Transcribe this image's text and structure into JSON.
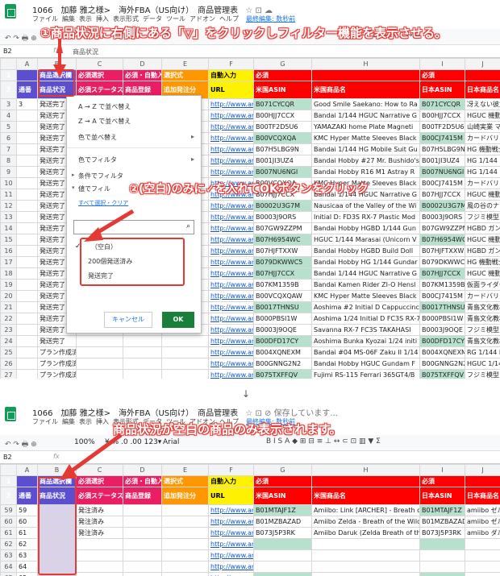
{
  "doc": {
    "title": "1066　加藤 雅之様>　海外FBA（US向け）　商品管理表",
    "title_icons": "☆ ⊡ ☁",
    "bot_title_icons": "☆ ⊡ ⊘ 保存しています..."
  },
  "menu": {
    "items": [
      "ファイル",
      "編集",
      "表示",
      "挿入",
      "表示形式",
      "データ",
      "ツール",
      "アドオン",
      "ヘルプ"
    ],
    "last_edit": "最終編集: 数秒前"
  },
  "formula_bar": {
    "cell_ref": "B2",
    "value": "商品状況"
  },
  "columns": [
    "",
    "A",
    "B",
    "C",
    "D",
    "E",
    "F",
    "G",
    "H",
    "I",
    "J"
  ],
  "header_row1": {
    "b": "商品選択欄",
    "c": "必須選択",
    "d": "必須・自動入",
    "e": "選択式",
    "f": "自動入力",
    "g": "必須",
    "i": "必須"
  },
  "header_row2": {
    "a": "通番",
    "b": "商品状況",
    "c": "必須ステータス",
    "d": "商品登録",
    "e": "追加発注分",
    "f": "URL",
    "g": "米国ASIN",
    "h": "米国商品名",
    "i": "日本ASIN",
    "j": "日本商品名"
  },
  "top_rows": [
    {
      "n": "3",
      "a": "3",
      "b": "発送完了",
      "f": "http://www.amaz",
      "g": "B071CYCQR",
      "h": "Good Smile Saekano: How to Ra",
      "i": "B071CYCQR",
      "j": "冴えない彼女"
    },
    {
      "n": "4",
      "a": "",
      "b": "発送完了",
      "f": "http://www.amaz",
      "g": "B00HJJ7CCX",
      "h": "Bandai 1/144 HGUC Narrative G",
      "i": "B00HJJ7CCX",
      "j": "HGUC 機動戦"
    },
    {
      "n": "5",
      "a": "",
      "b": "発送完了",
      "f": "http://www.amaz",
      "g": "B00TF2D5U6",
      "h": "YAMAZAKI home Plate Magneti",
      "i": "B00TF2D5U6",
      "j": "山崎実業 マグ"
    },
    {
      "n": "6",
      "a": "",
      "b": "発送完了",
      "f": "http://www.amaz",
      "g": "B00VCQXQA",
      "h": "KMC Hyper Matte Sleeves Black",
      "i": "B00CJ7415M",
      "j": "カードバリア"
    },
    {
      "n": "7",
      "a": "",
      "b": "発送完了",
      "f": "http://www.amaz",
      "g": "B07H5LBG9N",
      "h": "Bandai 1/144 HG Mobile Suit Gu",
      "i": "B07H5LBG9N",
      "j": "HG 機動戦士ガ"
    },
    {
      "n": "8",
      "a": "",
      "b": "発送完了",
      "f": "http://www.amaz",
      "g": "B001JI3UZ4",
      "h": "Bandai Hobby #27 Mr. Bushido's",
      "i": "B001JI3UZ4",
      "j": "HG 1/144 ス"
    },
    {
      "n": "9",
      "a": "",
      "b": "発送完了",
      "f": "http://www.amaz",
      "g": "B007NU6NGI",
      "h": "Bandai Hobby R16 M1 Astray R",
      "i": "B007NU6NGI",
      "j": "HG 1/144 R-1"
    },
    {
      "n": "10",
      "a": "",
      "b": "発送完了",
      "f": "http://www.amaz",
      "g": "B00VCQXQA",
      "h": "KMC Hyper Matte Sleeves Black",
      "i": "B00CJ7415M",
      "j": "カードバリア"
    },
    {
      "n": "11",
      "a": "",
      "b": "発送完了",
      "f": "http://www.amaz",
      "g": "B07HJJ7CCX",
      "h": "Bandai 1/144 HGUC Narrative G",
      "i": "B07HJJ7CCX",
      "j": "HGUC 機動戦"
    },
    {
      "n": "12",
      "a": "",
      "b": "発送完了",
      "f": "http://www.amaz",
      "g": "B0002U3G7M",
      "h": "Nausicaa of the Valley of the Wi",
      "i": "B0002U3G7M",
      "j": "風の谷のナウ"
    },
    {
      "n": "13",
      "a": "",
      "b": "発送完了",
      "f": "http://www.amaz",
      "g": "B0003J9ORS",
      "h": "Initial D: FD3S RX-7 Plastic Mod",
      "i": "B0003J9ORS",
      "j": "フジミ模型 頭"
    },
    {
      "n": "14",
      "a": "",
      "b": "発送完了",
      "f": "http://www.amaz",
      "g": "B07GW9ZZPM",
      "h": "Bandai Hobby HGBD 1/144 Gun",
      "i": "B07GW9ZZPM",
      "j": "HGBD ガンダ"
    },
    {
      "n": "15",
      "a": "",
      "b": "発送完了",
      "f": "http://www.amaz",
      "g": "B07H6954WC",
      "h": "HGUC 1/144 Marasai (Unicorn V",
      "i": "B07H6954WC",
      "j": "HGUC 機動戦"
    },
    {
      "n": "16",
      "a": "",
      "b": "発送完了",
      "f": "http://www.amaz",
      "g": "B07HJFTXXW",
      "h": "Bandai Hobby HGBD Build Doll",
      "i": "B07HJFTXXW",
      "j": "HGBD ガンダ"
    },
    {
      "n": "17",
      "a": "",
      "b": "発送完了",
      "f": "http://www.amaz",
      "g": "B079DKWWC5",
      "h": "Bandai Hobby HG 1/144 Gundar",
      "i": "B079DKWWC5",
      "j": "HG 機動戦士ガ"
    },
    {
      "n": "18",
      "a": "",
      "b": "発送完了",
      "f": "http://www.amaz",
      "g": "B07HJJ7CCX",
      "h": "Bandai 1/144 HGUC Narrative G",
      "i": "B07HJJ7CCX",
      "j": "HGUC 機動戦"
    },
    {
      "n": "19",
      "a": "",
      "b": "発送完了",
      "f": "http://www.amaz",
      "g": "B07KM1359B",
      "h": "Bandai Kamen Rider ZI-O Hensl",
      "i": "B07KM1359B",
      "j": "仮面ライダー"
    },
    {
      "n": "20",
      "a": "",
      "b": "発送完了",
      "f": "http://www.amaz",
      "g": "B00VCQXQAW",
      "h": "KMC Hyper Matte Sleeves Black",
      "i": "B00CJ7415M",
      "j": "カードバリア"
    },
    {
      "n": "21",
      "a": "",
      "b": "発送完了",
      "f": "http://www.amaz",
      "g": "B0017THNSU",
      "h": "Aoshima #2 Initial D Cappuccinc",
      "i": "B0017THNSU",
      "j": "青島文化教材"
    },
    {
      "n": "22",
      "a": "",
      "b": "発送完了",
      "f": "http://www.amaz",
      "g": "B000PBSI1W",
      "h": "Aoshima 1/24 Initial D FC3S RX-7 Pla",
      "i": "B000PBSI1W",
      "j": "青島文化教材"
    },
    {
      "n": "23",
      "a": "",
      "b": "発送完了",
      "f": "http://www.amaz",
      "g": "B0003J9OQE",
      "h": "Savanna RX-7 FC3S TAKAHASI",
      "i": "B0003J9OQE",
      "j": "フジミ模型 頭"
    },
    {
      "n": "24",
      "a": "",
      "b": "発送完了",
      "f": "http://www.amaz",
      "g": "B00DFD17CY",
      "h": "Aoshima Bunka Kyozai 1/24 initi",
      "i": "B00DFD17CY",
      "j": "青島文化教材"
    },
    {
      "n": "25",
      "a": "",
      "b": "プラン作成済",
      "f": "http://www.amaz",
      "g": "B004XQNEXM",
      "h": "Bandai #04 MS-06F Zaku II 1/14",
      "i": "B004XQNEXM",
      "j": "RG 1/144 MS"
    },
    {
      "n": "26",
      "a": "",
      "b": "プラン作成済",
      "f": "http://www.amaz",
      "g": "B00GNNG2N2",
      "h": "Bandai Hobby HGUC Gundam F",
      "i": "B00GNNG2N2",
      "j": "HGUC 1/144"
    },
    {
      "n": "27",
      "a": "",
      "b": "プラン作成済",
      "f": "http://www.amaz",
      "g": "B075TXFFQV",
      "h": "Fujimi RS-115 Ferrari 365GT4/B",
      "i": "B075TXFFQV",
      "j": "フジミ模型 1"
    },
    {
      "n": "28",
      "a": "",
      "b": "プラン作成済",
      "f": "http://www.amaz",
      "g": "B07NSWUCFQ",
      "h": "Bandai Hobby HG #34 Regalaz",
      "i": "B07NSWUCFQ",
      "j": "HG ガンダムビ"
    }
  ],
  "filter_menu": {
    "sort_az": "A → Z で並べ替え",
    "sort_za": "Z → A で並べ替え",
    "sort_color": "色で並べ替え",
    "filter_color": "色でフィルタ",
    "filter_condition": "条件でフィルタ",
    "filter_value": "値でフィル",
    "select_all": "すべて選択・クリア",
    "options": [
      "（空白）",
      "200個発送済み",
      "発送完了"
    ],
    "cancel": "キャンセル",
    "ok": "OK"
  },
  "annotations": {
    "step1": "①商品状況に右側にある「▽」をクリックしフィルター機能を表示させる。",
    "step2": "②(空白)のみに✓を入れてOKボタンをクリック",
    "step3": "商品状況が空白の商品のみ表示されます。"
  },
  "toolbar_bottom": {
    "zoom": "100%",
    "font": "Arial",
    "fmt": "¥ % .0 .00 123▾"
  },
  "bottom_rows": [
    {
      "n": "59",
      "a": "59",
      "c": "発注済み",
      "f": "http://www.amaz",
      "g": "B01MTAJF1Z",
      "h": "Amiibo: Link [ARCHER] - Breath of the",
      "i": "B01MTAJF1Z",
      "j": "amiibo ゼル"
    },
    {
      "n": "60",
      "a": "60",
      "c": "発注済み",
      "f": "http://www.amaz",
      "g": "B01MZBAZAD",
      "h": "Amiibo Zelda - Breath of the Wild (The",
      "i": "B01MZBAZAD",
      "j": "amiibo ゼル"
    },
    {
      "n": "61",
      "a": "61",
      "c": "発注済み",
      "f": "http://www.amaz",
      "g": "B073J5P3RK",
      "h": "Amiibo Daruk (Zelda Breath of the Wild",
      "i": "B073J5P3RK",
      "j": "amiibo ダル"
    },
    {
      "n": "62",
      "a": "62",
      "c": "",
      "f": "http://www.amaz",
      "g": "",
      "h": "",
      "i": "",
      "j": ""
    },
    {
      "n": "63",
      "a": "63",
      "c": "",
      "f": "http://www.amaz",
      "g": "",
      "h": "",
      "i": "",
      "j": ""
    },
    {
      "n": "64",
      "a": "64",
      "c": "",
      "f": "http://www.amaz",
      "g": "",
      "h": "",
      "i": "",
      "j": ""
    },
    {
      "n": "65",
      "a": "65",
      "c": "",
      "f": "http://www.amaz",
      "g": "",
      "h": "",
      "i": "",
      "j": ""
    }
  ],
  "colors": {
    "accent_red": "#e53935",
    "header_purple": "#5b4fcf",
    "header_pink": "#e91e63",
    "header_red": "#ff0000",
    "link": "#1155cc"
  }
}
